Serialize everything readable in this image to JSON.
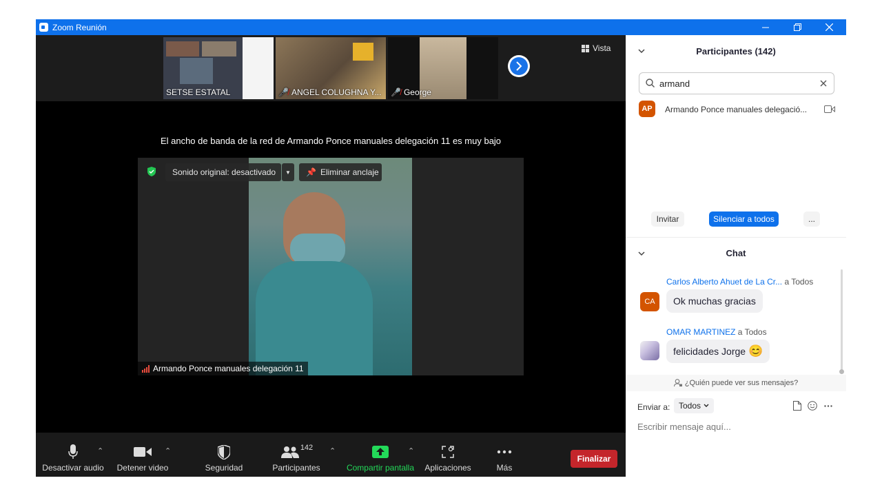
{
  "window": {
    "title": "Zoom Reunión"
  },
  "thumbnails": [
    {
      "name": "SETSE ESTATAL",
      "muted": false
    },
    {
      "name": "ANGEL COLUGHNA Y...",
      "muted": true
    },
    {
      "name": "George",
      "muted": true
    }
  ],
  "view_button": {
    "label": "Vista"
  },
  "bandwidth_message": "El ancho de banda de la red de Armando Ponce manuales delegación 11 es muy bajo",
  "main_video": {
    "original_sound": "Sonido original: desactivado",
    "unpin": "Eliminar anclaje",
    "speaker_name": "Armando Ponce manuales delegación 11"
  },
  "toolbar": {
    "audio": "Desactivar audio",
    "video": "Detener video",
    "security": "Seguridad",
    "participants": "Participantes",
    "participants_count": "142",
    "share": "Compartir pantalla",
    "apps": "Aplicaciones",
    "more": "Más",
    "end": "Finalizar"
  },
  "participants_panel": {
    "title": "Participantes (142)",
    "search_value": "armand",
    "results": [
      {
        "initials": "AP",
        "name": "Armando Ponce manuales delegació..."
      }
    ],
    "invite": "Invitar",
    "mute_all": "Silenciar a todos",
    "more": "..."
  },
  "chat": {
    "title": "Chat",
    "messages": [
      {
        "initials": "CA",
        "sender": "Carlos Alberto Ahuet de La Cr...",
        "to": "a Todos",
        "text": "Ok muchas gracias"
      },
      {
        "initials": "",
        "sender": "OMAR MARTINEZ",
        "to": "a Todos",
        "text": "felicidades Jorge",
        "emoji": "😊"
      }
    ],
    "who_can_see": "¿Quién puede ver sus mensajes?",
    "send_to_label": "Enviar a:",
    "send_to_value": "Todos",
    "placeholder": "Escribir mensaje aquí..."
  },
  "colors": {
    "zoom_blue": "#0e71eb",
    "end_red": "#c4262b",
    "share_green": "#23d959",
    "avatar_orange": "#d35400"
  }
}
